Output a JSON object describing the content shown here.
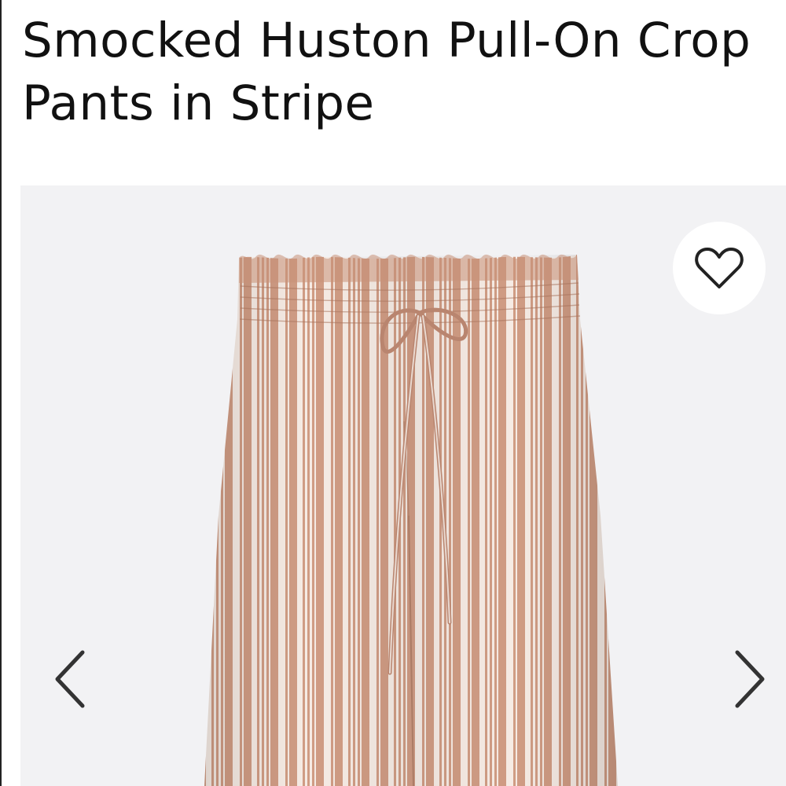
{
  "product": {
    "title": "Smocked Huston Pull-On Crop Pants in Stripe"
  },
  "gallery": {
    "favorite_icon": "heart-outline-icon",
    "prev_icon": "chevron-left-icon",
    "next_icon": "chevron-right-icon"
  },
  "colors": {
    "gallery_background": "#f2f2f4",
    "fabric_base": "#d3a38a",
    "stripe_light": "#f7ebe4",
    "icon": "#333333"
  }
}
